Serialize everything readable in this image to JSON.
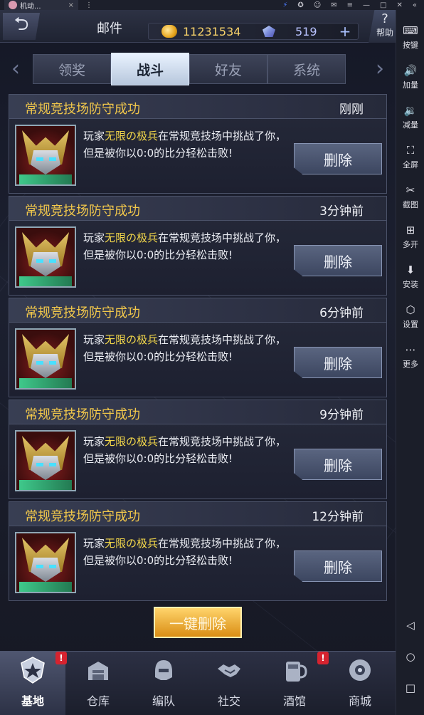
{
  "emulator": {
    "tab_title": "机动...",
    "close_symbol": "×",
    "menu_symbol": "⋮",
    "sidebar": [
      {
        "icon": "keyboard-icon",
        "glyph": "⌨",
        "label": "按键"
      },
      {
        "icon": "volume-up-icon",
        "glyph": "🔊",
        "label": "加量"
      },
      {
        "icon": "volume-down-icon",
        "glyph": "🔉",
        "label": "减量"
      },
      {
        "icon": "fullscreen-icon",
        "glyph": "⛶",
        "label": "全屏"
      },
      {
        "icon": "scissors-icon",
        "glyph": "✂",
        "label": "截图"
      },
      {
        "icon": "multi-instance-icon",
        "glyph": "⊞",
        "label": "多开"
      },
      {
        "icon": "apk-install-icon",
        "glyph": "⬇",
        "label": "安装"
      },
      {
        "icon": "settings-hex-icon",
        "glyph": "⬡",
        "label": "设置"
      },
      {
        "icon": "more-icon",
        "glyph": "⋯",
        "label": "更多"
      }
    ],
    "android_nav": {
      "back": "◁",
      "home": "○",
      "recents": "□"
    }
  },
  "header": {
    "back_glyph": "⮌",
    "title": "邮件",
    "gold": "11231534",
    "gems": "519",
    "plus": "+",
    "help_glyph": "?",
    "help_label": "帮助"
  },
  "tabs": {
    "left_arrow": "‹",
    "right_arrow": "›",
    "items": [
      "领奖",
      "战斗",
      "好友",
      "系统"
    ],
    "active_index": 1
  },
  "mails": [
    {
      "subject": "常规竞技场防守成功",
      "time": "刚刚",
      "prefix": "玩家",
      "player": "无限の极兵",
      "suffix": "在常规竞技场中挑战了你，但是被你以0:0的比分轻松击败!",
      "delete_label": "删除"
    },
    {
      "subject": "常规竞技场防守成功",
      "time": "3分钟前",
      "prefix": "玩家",
      "player": "无限の极兵",
      "suffix": "在常规竞技场中挑战了你，但是被你以0:0的比分轻松击败!",
      "delete_label": "删除"
    },
    {
      "subject": "常规竞技场防守成功",
      "time": "6分钟前",
      "prefix": "玩家",
      "player": "无限の极兵",
      "suffix": "在常规竞技场中挑战了你，但是被你以0:0的比分轻松击败!",
      "delete_label": "删除"
    },
    {
      "subject": "常规竞技场防守成功",
      "time": "9分钟前",
      "prefix": "玩家",
      "player": "无限の极兵",
      "suffix": "在常规竞技场中挑战了你，但是被你以0:0的比分轻松击败!",
      "delete_label": "删除"
    },
    {
      "subject": "常规竞技场防守成功",
      "time": "12分钟前",
      "prefix": "玩家",
      "player": "无限の极兵",
      "suffix": "在常规竞技场中挑战了你，但是被你以0:0的比分轻松击败!",
      "delete_label": "删除"
    }
  ],
  "one_key_delete": "一键删除",
  "bottom_nav": [
    {
      "label": "基地",
      "icon": "base-shield-icon",
      "badge": "!",
      "active": true
    },
    {
      "label": "仓库",
      "icon": "warehouse-icon",
      "badge": "",
      "active": false
    },
    {
      "label": "编队",
      "icon": "squad-helmet-icon",
      "badge": "",
      "active": false
    },
    {
      "label": "社交",
      "icon": "handshake-icon",
      "badge": "",
      "active": false
    },
    {
      "label": "酒馆",
      "icon": "tavern-mug-icon",
      "badge": "!",
      "active": false
    },
    {
      "label": "商城",
      "icon": "shop-orb-icon",
      "badge": "",
      "active": false
    }
  ],
  "colors": {
    "accent_gold": "#f2c84b",
    "highlight_name": "#f4d84a",
    "badge_red": "#d6232f"
  }
}
